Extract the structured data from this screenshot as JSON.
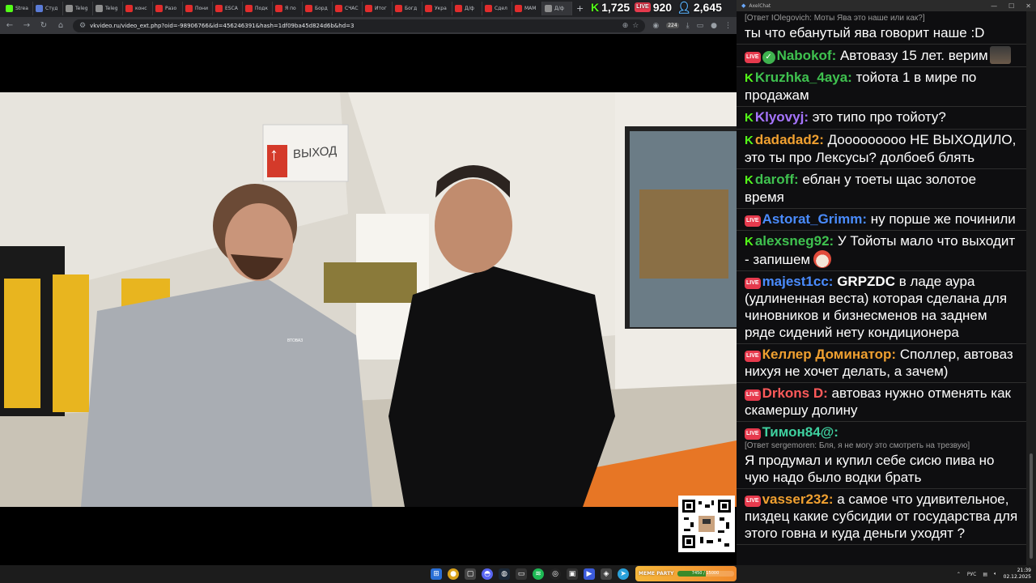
{
  "browser": {
    "tabs": [
      {
        "label": "Strea",
        "color": "#53fc18"
      },
      {
        "label": "Студ",
        "color": "#5a7bd6"
      },
      {
        "label": "Teleg",
        "color": "#8e8e8e"
      },
      {
        "label": "Teleg",
        "color": "#8e8e8e"
      },
      {
        "label": "конс",
        "color": "#e02c2c"
      },
      {
        "label": "Разо",
        "color": "#e02c2c"
      },
      {
        "label": "Пони",
        "color": "#e02c2c"
      },
      {
        "label": "ESCA",
        "color": "#e02c2c"
      },
      {
        "label": "Подк",
        "color": "#e02c2c"
      },
      {
        "label": "Я по",
        "color": "#e02c2c"
      },
      {
        "label": "Борд",
        "color": "#e02c2c"
      },
      {
        "label": "СЧАС",
        "color": "#e02c2c"
      },
      {
        "label": "Итог",
        "color": "#e02c2c"
      },
      {
        "label": "Богд",
        "color": "#e02c2c"
      },
      {
        "label": "Укра",
        "color": "#e02c2c"
      },
      {
        "label": "Д/ф",
        "color": "#e02c2c"
      },
      {
        "label": "Сдел",
        "color": "#e02c2c"
      },
      {
        "label": "МАМ",
        "color": "#e02c2c"
      },
      {
        "label": "Д/ф",
        "color": "#8e8e8e"
      }
    ],
    "new_tab": "+",
    "url": "vkvideo.ru/video_ext.php?oid=-98906766&id=456246391&hash=1df09ba45d824d6b&hd=3",
    "ext_badge": "224"
  },
  "stats": {
    "kick_count": "1,725",
    "live_count": "920",
    "viewers": "2,645",
    "live_badge": "LIVE",
    "kick_icon": "K"
  },
  "chat": {
    "window_title": "AxelChat",
    "live_badge": "LIVE",
    "kick_badge": "K",
    "messages": [
      {
        "reply": "[Ответ IOlegovich: Моты Ява это наше или как?]",
        "text": "ты что ебанутый ява говорит наше :D"
      },
      {
        "user": "Nabokof:",
        "color": "#3fc24f",
        "text": " Автовазу 15 лет. верим"
      },
      {
        "user": "Kruzhka_4aya:",
        "color": "#3fc24f",
        "text": " тойота 1 в мире по продажам"
      },
      {
        "user": "Klyovyj:",
        "color": "#a675ff",
        "text": " это типо про тойоту?"
      },
      {
        "user": "dadadad2:",
        "color": "#f0a030",
        "text": " Доооооооoo НЕ ВЫХОДИЛО, это ты про Лексусы? долбоеб блять"
      },
      {
        "user": "daroff:",
        "color": "#3fc24f",
        "text": " еблан у тоеты щас золотое время"
      },
      {
        "user": "Astorat_Grimm:",
        "color": "#4a8cff",
        "text": " ну порше же починили"
      },
      {
        "user": "alexsneg92:",
        "color": "#3fc24f",
        "text": " У Тойоты мало что выходит - запишем"
      },
      {
        "user": "majest1cc:",
        "color": "#4a8cff",
        "mention": "GRPZDC",
        "text": " в ладе аура (удлиненная веста) которая сделана для чиновников и бизнесменов на заднем ряде сидений нету кондиционера"
      },
      {
        "user": "Келлер Доминатор:",
        "color": "#f0a030",
        "text": " Споллер, автоваз нихуя не хочет делать, а зачем)"
      },
      {
        "user": "Drkons D:",
        "color": "#ff5a5a",
        "text": " автоваз нужно отменять как скамершу долину"
      },
      {
        "user": "Тимон84@:",
        "color": "#3fd1a0",
        "reply": "[Ответ sergemoren: Бля, я не могу это смотреть на трезвую]",
        "text": "Я продумал и купил себе сисю пива но чую надо было водки брать"
      },
      {
        "user": "vasser232:",
        "color": "#f0a030",
        "text": " а самое что удивительное, пиздец какие субсидии от государства для этого говна и куда деньги уходят ?"
      }
    ]
  },
  "video": {
    "sign_text": "ВЫХОД",
    "sign_arrow": "↑",
    "jacket_logo": "ВТОВАЗ"
  },
  "taskbar": {
    "meme_label": "MEME PARTY",
    "meme_count": "7450 / 15000",
    "meme_progress": 0.5,
    "lang": "РУС",
    "time": "21:39",
    "date": "02.12.2025"
  },
  "colors": {
    "kick_green": "#53fc18",
    "live_red": "#e63a4d",
    "chat_bg": "#0e0e10"
  }
}
